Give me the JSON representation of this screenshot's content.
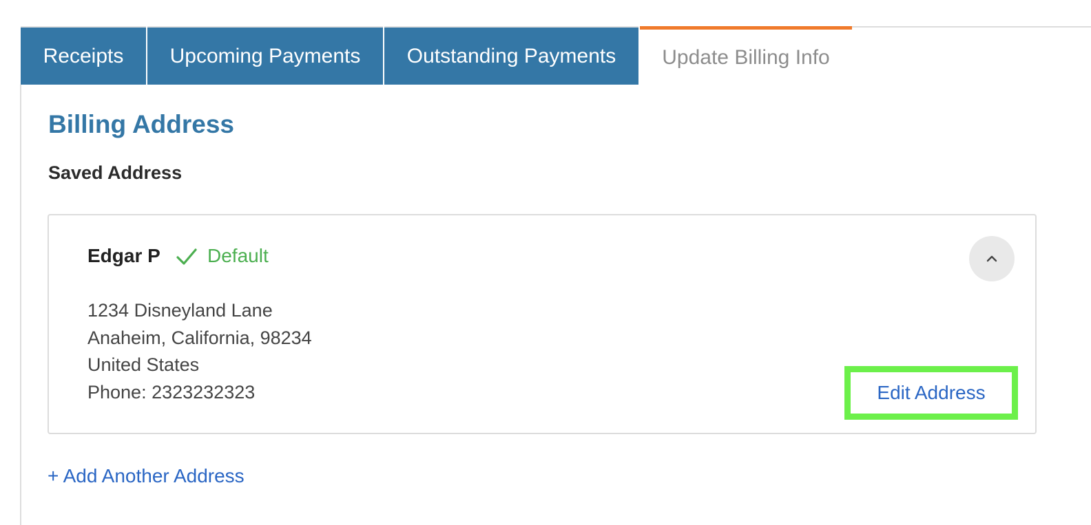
{
  "tabs": {
    "receipts": "Receipts",
    "upcoming": "Upcoming Payments",
    "outstanding": "Outstanding Payments",
    "update_billing": "Update Billing Info"
  },
  "section": {
    "title": "Billing Address",
    "saved_label": "Saved Address"
  },
  "address": {
    "name": "Edgar P",
    "default_label": "Default",
    "line1": "1234 Disneyland Lane",
    "line2": "Anaheim, California, 98234",
    "line3": "United States",
    "phone": "Phone: 2323232323",
    "edit_label": "Edit Address"
  },
  "actions": {
    "add_another": "+ Add Another Address"
  },
  "icons": {
    "check": "check-icon",
    "collapse": "chevron-up-icon"
  },
  "colors": {
    "tab_blue": "#3477a6",
    "active_accent": "#f07a2b",
    "default_green": "#4caf50",
    "link_blue": "#2a66c4",
    "highlight_green": "#6cf04a"
  }
}
